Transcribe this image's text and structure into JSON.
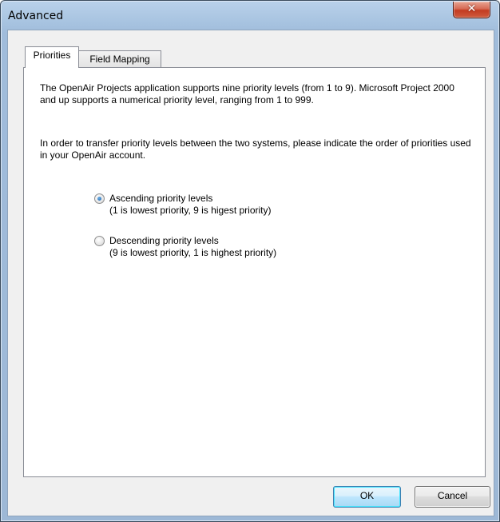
{
  "window": {
    "title": "Advanced",
    "close_glyph": "✕"
  },
  "tabs": [
    {
      "label": "Priorities",
      "active": true
    },
    {
      "label": "Field Mapping",
      "active": false
    }
  ],
  "priorities": {
    "intro": "The OpenAir Projects application supports nine priority levels (from 1 to 9).  Microsoft Project 2000 and up supports a numerical priority level, ranging from 1 to 999.",
    "instruction": "In order to transfer priority levels between the two systems, please indicate the order of priorities used in your OpenAir account.",
    "options": [
      {
        "label": "Ascending priority levels",
        "detail": "(1 is lowest priority, 9 is higest priority)",
        "selected": true
      },
      {
        "label": "Descending priority levels",
        "detail": "(9 is lowest priority, 1 is highest priority)",
        "selected": false
      }
    ]
  },
  "buttons": {
    "ok": "OK",
    "cancel": "Cancel"
  }
}
